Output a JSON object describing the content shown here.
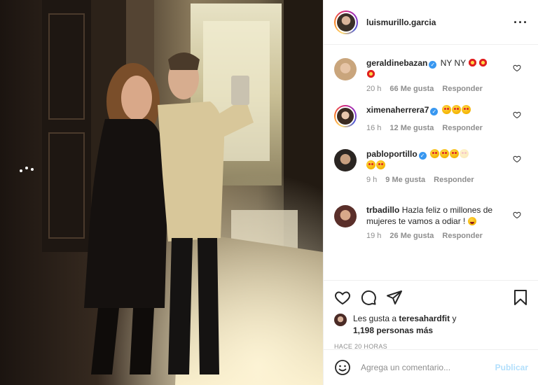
{
  "post": {
    "author": "luismurillo.garcia",
    "more_icon": "more-horizontal-icon"
  },
  "comments": [
    {
      "user": "geraldinebazan",
      "verified": true,
      "text": "NY NY",
      "emoji": [
        "collision",
        "collision",
        "collision"
      ],
      "time": "20 h",
      "likes": "66 Me gusta",
      "reply": "Responder"
    },
    {
      "user": "ximenaherrera7",
      "verified": true,
      "text": "",
      "emoji": [
        "star-struck",
        "star-struck",
        "star-struck"
      ],
      "time": "16 h",
      "likes": "12 Me gusta",
      "reply": "Responder"
    },
    {
      "user": "pabloportillo",
      "verified": true,
      "text": "",
      "emoji": [
        "star-struck",
        "star-struck",
        "star-struck",
        "star-struck",
        "star-struck",
        "star-struck"
      ],
      "time": "9 h",
      "likes": "9 Me gusta",
      "reply": "Responder"
    },
    {
      "user": "trbadillo",
      "verified": false,
      "text": "Hazla feliz o millones de mujeres te vamos a odiar !",
      "emoji": [
        "hugging"
      ],
      "time": "19 h",
      "likes": "26 Me gusta",
      "reply": "Responder"
    }
  ],
  "actions": {
    "like_icon": "heart-icon",
    "comment_icon": "comment-icon",
    "share_icon": "paper-plane-icon",
    "save_icon": "bookmark-icon"
  },
  "likes": {
    "prefix": "Les gusta a",
    "user": "teresahardfit",
    "conj": "y",
    "others": "1,198 personas más"
  },
  "time_ago": "HACE 20 HORAS",
  "composer": {
    "placeholder": "Agrega un comentario...",
    "publish": "Publicar",
    "emoji_icon": "smiley-icon"
  },
  "colors": {
    "verified": "#3897f0",
    "publish_disabled": "#b2dffc",
    "secondary_text": "#8e8e8e"
  }
}
